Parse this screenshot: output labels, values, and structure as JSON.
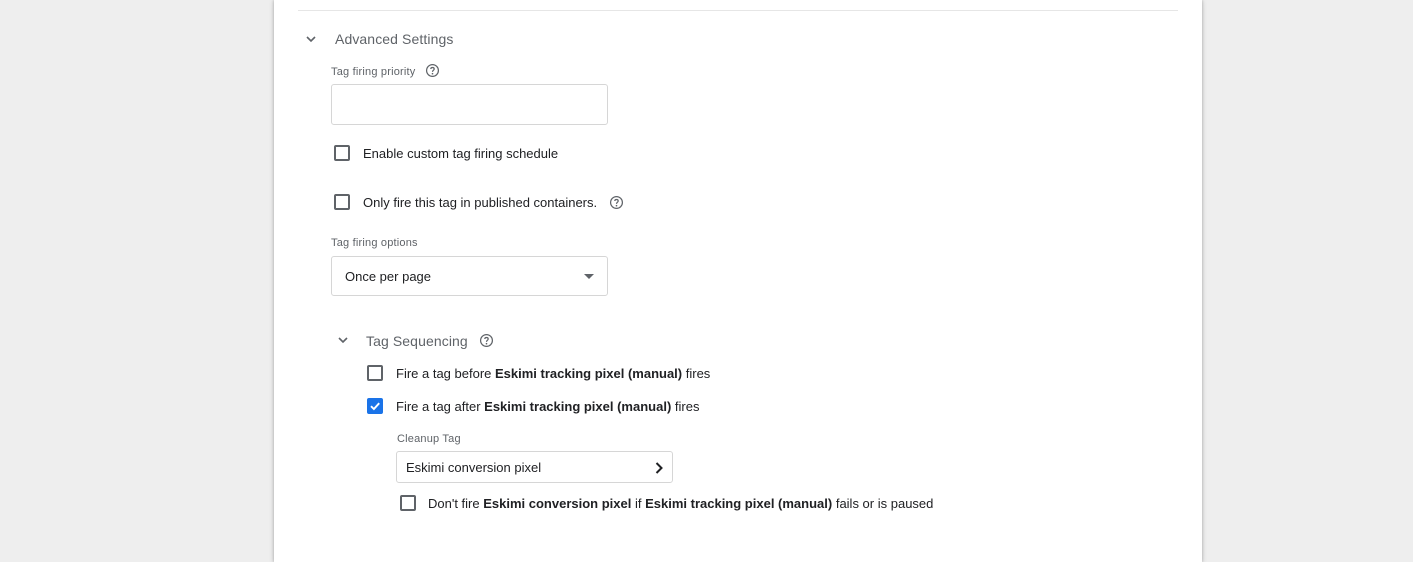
{
  "advanced_settings": {
    "title": "Advanced Settings",
    "tag_firing_priority": {
      "label": "Tag firing priority",
      "value": "",
      "placeholder": ""
    },
    "custom_schedule_checkbox": {
      "label": "Enable custom tag firing schedule",
      "checked": false
    },
    "published_only_checkbox": {
      "label": "Only fire this tag in published containers.",
      "checked": false
    },
    "tag_firing_options": {
      "label": "Tag firing options",
      "selected": "Once per page"
    }
  },
  "tag_sequencing": {
    "title": "Tag Sequencing",
    "fire_before": {
      "prefix": "Fire a tag before ",
      "tag_name": "Eskimi tracking pixel (manual)",
      "suffix": " fires",
      "checked": false
    },
    "fire_after": {
      "prefix": "Fire a tag after ",
      "tag_name": "Eskimi tracking pixel (manual)",
      "suffix": " fires",
      "checked": true
    },
    "cleanup_tag": {
      "label": "Cleanup Tag",
      "value": "Eskimi conversion pixel"
    },
    "dont_fire": {
      "prefix": "Don't fire ",
      "cleanup_name": "Eskimi conversion pixel",
      "middle": " if ",
      "main_name": "Eskimi tracking pixel (manual)",
      "suffix": " fails or is paused",
      "checked": false
    }
  },
  "colors": {
    "accent": "#1a73e8",
    "background": "#eeeeee",
    "panel": "#ffffff",
    "muted_text": "#5f6368"
  },
  "icons": {
    "section_toggle": "chevron-down-icon",
    "help": "help-circle-icon",
    "dropdown": "caret-down-icon",
    "navigate": "chevron-right-icon",
    "check": "check-icon"
  }
}
